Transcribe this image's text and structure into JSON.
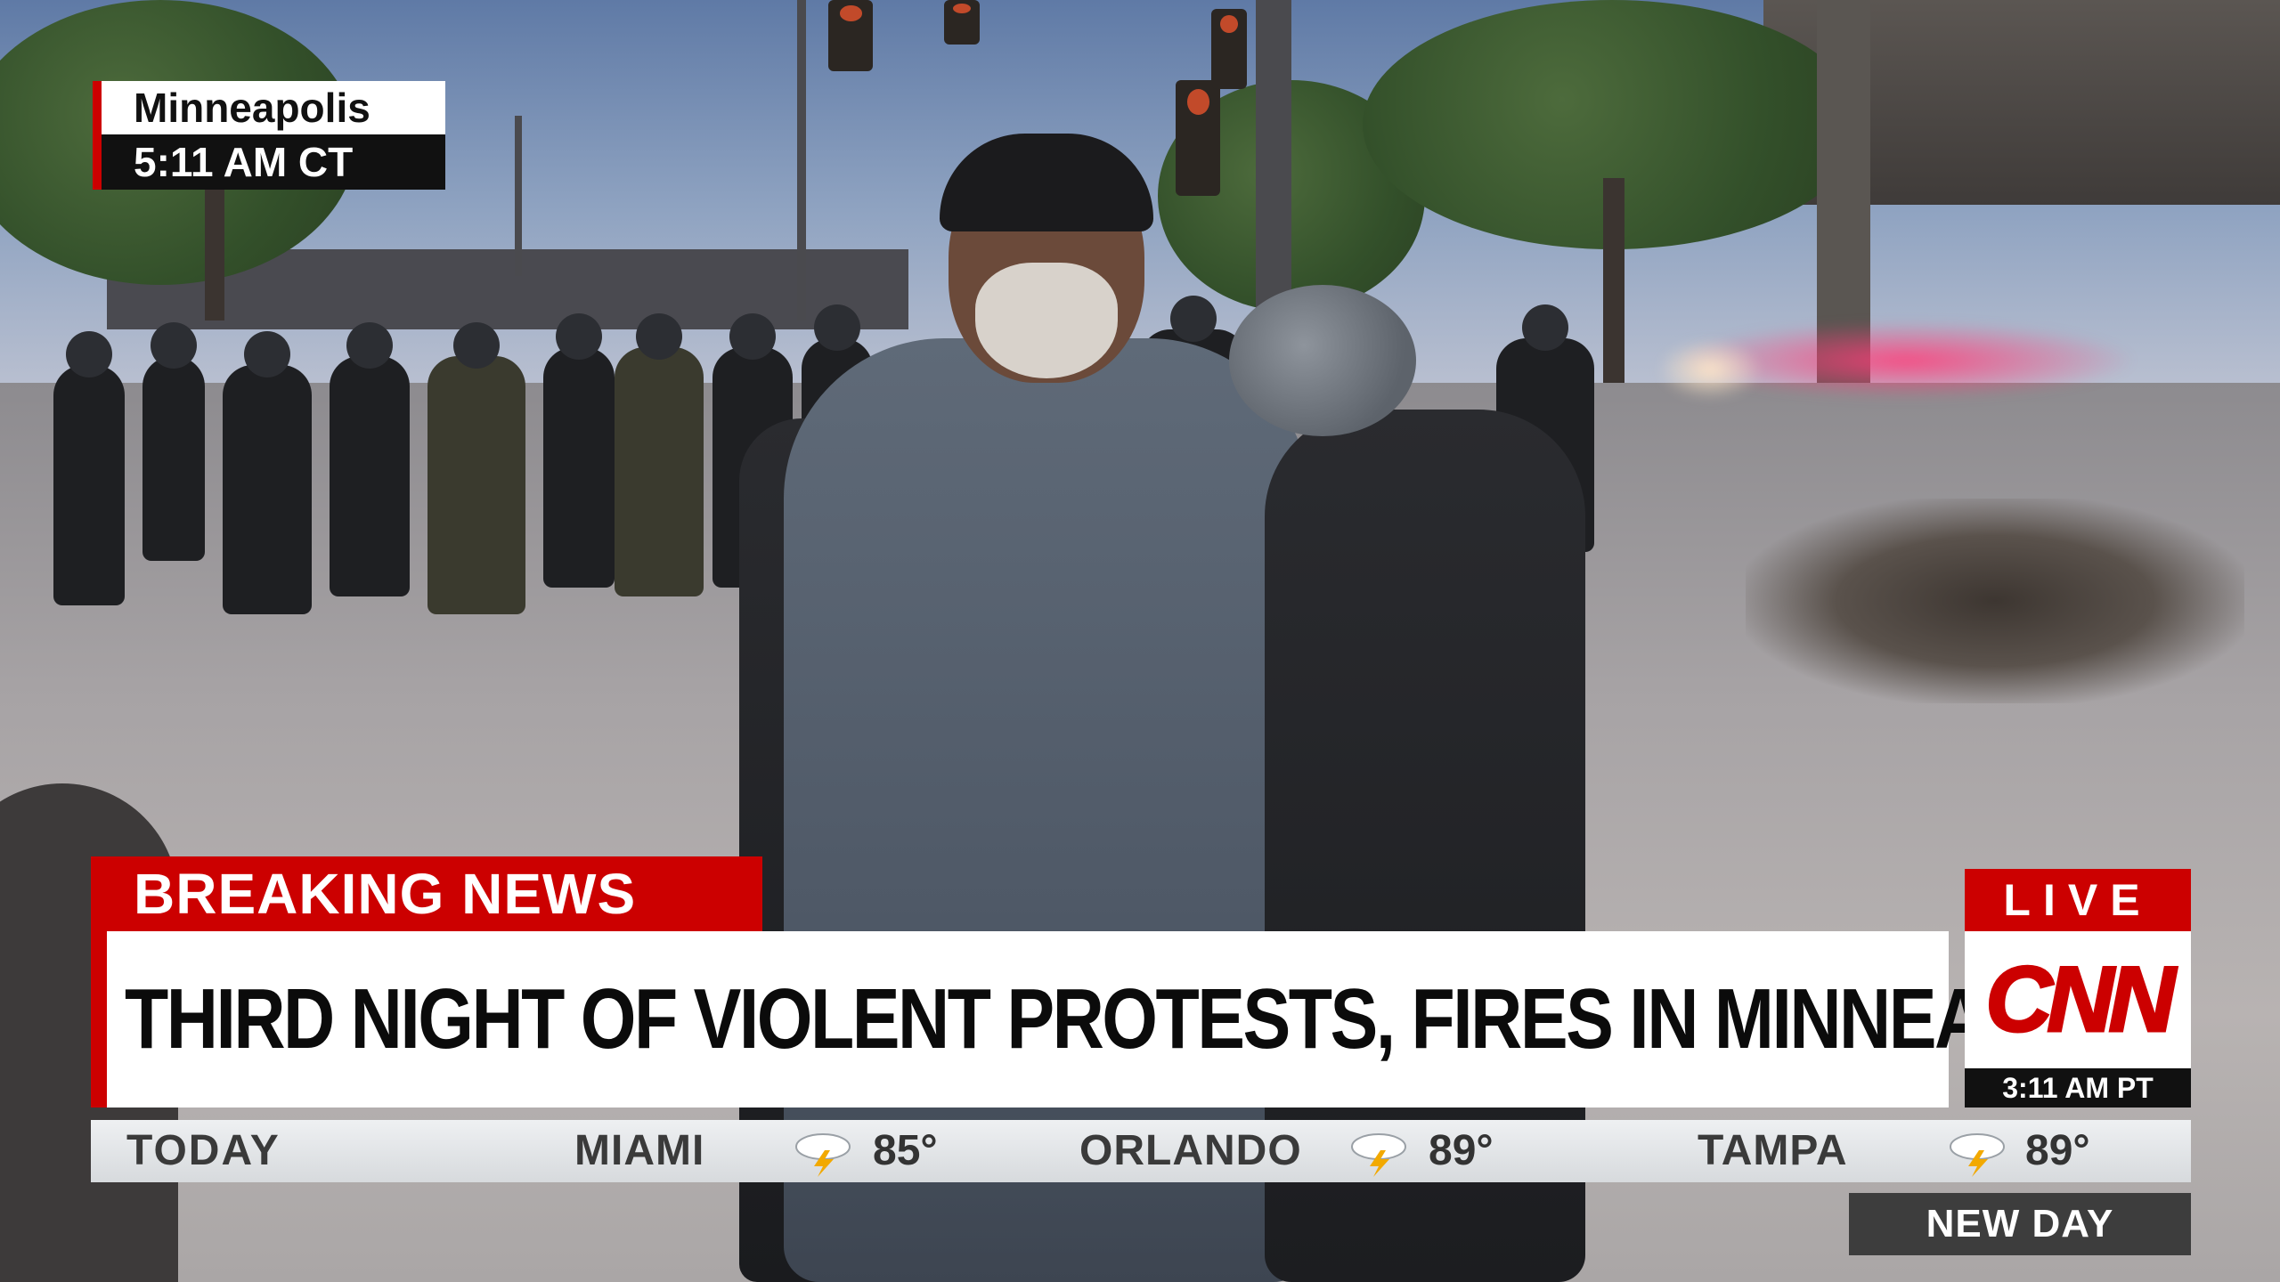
{
  "location_tag": {
    "city": "Minneapolis",
    "local_time": "5:11 AM CT"
  },
  "lower_third": {
    "banner": "BREAKING NEWS",
    "headline": "THIRD NIGHT OF VIOLENT PROTESTS, FIRES IN MINNEAPOLIS"
  },
  "bug": {
    "live_label": "LIVE",
    "network": "CNN",
    "time": "3:11 AM PT",
    "logo_color": "#cc0000"
  },
  "weather_ticker": {
    "label": "TODAY",
    "cities": [
      {
        "name": "MIAMI",
        "icon": "thunderstorm-icon",
        "temp": "85°"
      },
      {
        "name": "ORLANDO",
        "icon": "thunderstorm-icon",
        "temp": "89°"
      },
      {
        "name": "TAMPA",
        "icon": "thunderstorm-icon",
        "temp": "89°"
      }
    ]
  },
  "program": {
    "show_name": "NEW DAY"
  },
  "colors": {
    "accent_red": "#cc0000",
    "ticker_bg": "#e2e5e8",
    "dark": "#111111"
  }
}
